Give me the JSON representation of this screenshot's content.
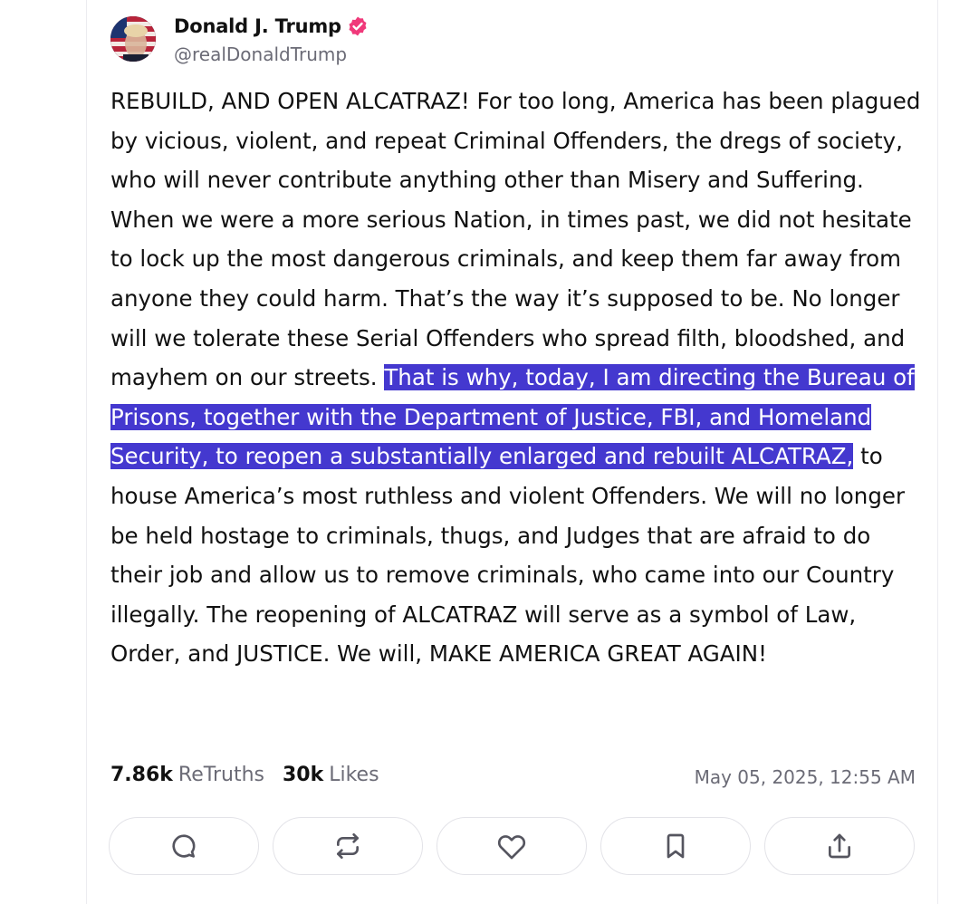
{
  "author": {
    "display_name": "Donald J. Trump",
    "handle": "@realDonaldTrump",
    "avatar_icon": "user-avatar-flag",
    "verified_icon": "verified-badge-icon",
    "verified_color": "#f0397a"
  },
  "post": {
    "text_before": "REBUILD, AND OPEN ALCATRAZ! For too long, America has been plagued by vicious, violent, and repeat Criminal Offenders, the dregs of society, who will never contribute anything other than Misery and Suffering. When we were a more serious Nation, in times past, we did not hesitate to lock up the most dangerous criminals, and keep them far away from anyone they could harm. That’s the way it’s supposed to be. No longer will we tolerate these Serial Offenders who spread filth, bloodshed, and mayhem on our streets. ",
    "text_highlighted": "That is why, today, I am directing the Bureau of Prisons, together with the Department of Justice, FBI, and Homeland Security, to reopen a substantially enlarged and rebuilt ALCATRAZ,",
    "text_after": " to house America’s most ruthless and violent Offenders. We will no longer be held hostage to criminals, thugs, and Judges that are afraid to do their job and allow us to remove criminals, who came into our Country illegally. The reopening of ALCATRAZ will serve as a symbol of Law, Order, and JUSTICE. We will, MAKE AMERICA GREAT AGAIN!",
    "highlight_color": "#4438cf"
  },
  "stats": {
    "retruths_count": "7.86k",
    "retruths_label": "ReTruths",
    "likes_count": "30k",
    "likes_label": "Likes",
    "timestamp": "May 05, 2025, 12:55 AM"
  },
  "actions": [
    {
      "icon": "comment-icon"
    },
    {
      "icon": "retruth-icon"
    },
    {
      "icon": "heart-icon"
    },
    {
      "icon": "bookmark-icon"
    },
    {
      "icon": "share-icon"
    }
  ]
}
